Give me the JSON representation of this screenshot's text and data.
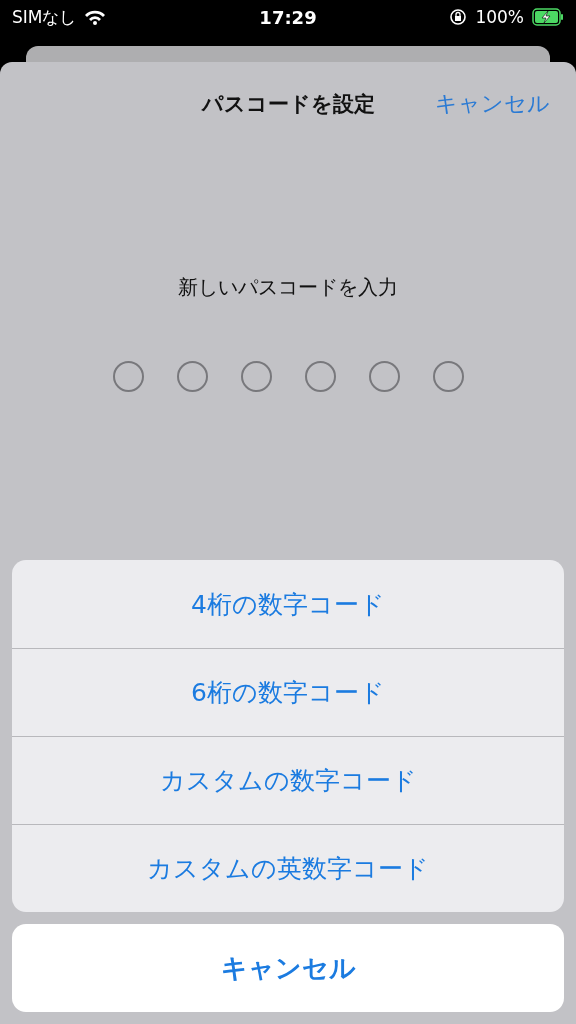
{
  "status_bar": {
    "carrier": "SIMなし",
    "time": "17:29",
    "battery": "100%",
    "charging": true
  },
  "nav": {
    "title": "パスコードを設定",
    "cancel": "キャンセル"
  },
  "prompt": "新しいパスコードを入力",
  "pin_dots": [
    {
      "filled": false
    },
    {
      "filled": false
    },
    {
      "filled": false
    },
    {
      "filled": false
    },
    {
      "filled": false
    },
    {
      "filled": false
    }
  ],
  "action_sheet": {
    "options": [
      "4桁の数字コード",
      "6桁の数字コード",
      "カスタムの数字コード",
      "カスタムの英数字コード"
    ],
    "cancel": "キャンセル"
  }
}
